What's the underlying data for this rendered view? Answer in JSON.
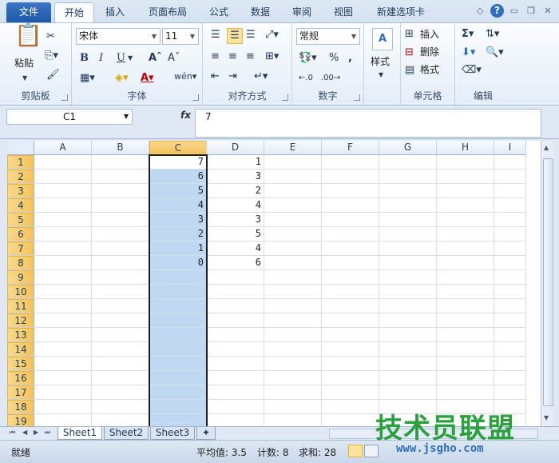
{
  "ribbon_tabs": [
    "文件",
    "开始",
    "插入",
    "页面布局",
    "公式",
    "数据",
    "审阅",
    "视图",
    "新建选项卡"
  ],
  "active_tab": "开始",
  "clipboard": {
    "paste": "粘贴",
    "label": "剪贴板"
  },
  "font": {
    "name": "宋体",
    "size": "11",
    "label": "字体"
  },
  "alignment": {
    "label": "对齐方式"
  },
  "number": {
    "format": "常规",
    "label": "数字"
  },
  "styles": {
    "label": "样式"
  },
  "cells": {
    "insert": "插入",
    "delete": "删除",
    "format": "格式",
    "label": "单元格"
  },
  "editing": {
    "label": "编辑"
  },
  "name_box": "C1",
  "formula": "7",
  "fx": "fx",
  "columns": [
    "A",
    "B",
    "C",
    "D",
    "E",
    "F",
    "G",
    "H",
    "I"
  ],
  "rows": [
    "1",
    "2",
    "3",
    "4",
    "5",
    "6",
    "7",
    "8",
    "9",
    "10",
    "11",
    "12",
    "13",
    "14",
    "15",
    "16",
    "17",
    "18",
    "19"
  ],
  "selected_column": "C",
  "col_c": [
    "7",
    "6",
    "5",
    "4",
    "3",
    "2",
    "1",
    "0"
  ],
  "col_d": [
    "1",
    "3",
    "2",
    "4",
    "3",
    "5",
    "4",
    "6"
  ],
  "sheets": [
    "Sheet1",
    "Sheet2",
    "Sheet3"
  ],
  "active_sheet": "Sheet1",
  "status": {
    "ready": "就绪",
    "average": "平均值: 3.5",
    "count": "计数: 8",
    "sum": "求和: 28"
  },
  "watermark": {
    "line1": "技术员联盟",
    "line2": "www.jsgho.com"
  }
}
